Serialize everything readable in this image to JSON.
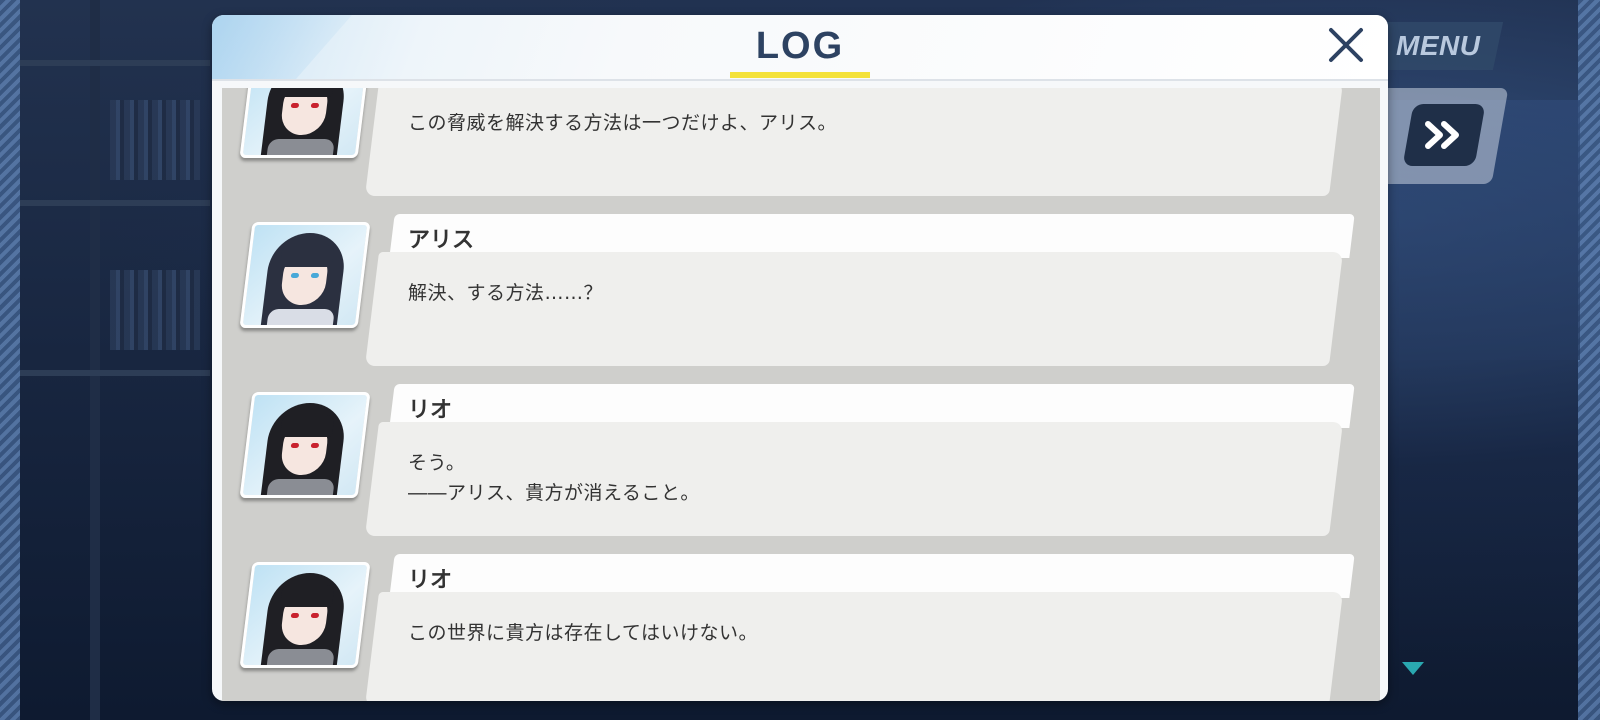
{
  "log": {
    "title": "LOG"
  },
  "menu": {
    "label": "MENU"
  },
  "entries": [
    {
      "speaker": "",
      "character": "rio",
      "lines": [
        "この脅威を解決する方法は一つだけよ、アリス。"
      ]
    },
    {
      "speaker": "アリス",
      "character": "arisu",
      "lines": [
        "解決、する方法……？"
      ]
    },
    {
      "speaker": "リオ",
      "character": "rio",
      "lines": [
        "そう。",
        "――アリス、貴方が消えること。"
      ]
    },
    {
      "speaker": "リオ",
      "character": "rio",
      "lines": [
        "この世界に貴方は存在してはいけない。"
      ]
    }
  ],
  "colors": {
    "title": "#2d4262",
    "title_underline": "#f4e23a",
    "scroll_indicator": "#2aa8b0"
  },
  "icons": {
    "close": "close-icon",
    "fast_forward": "fast-forward-icon",
    "scroll_down": "triangle-down-icon"
  }
}
